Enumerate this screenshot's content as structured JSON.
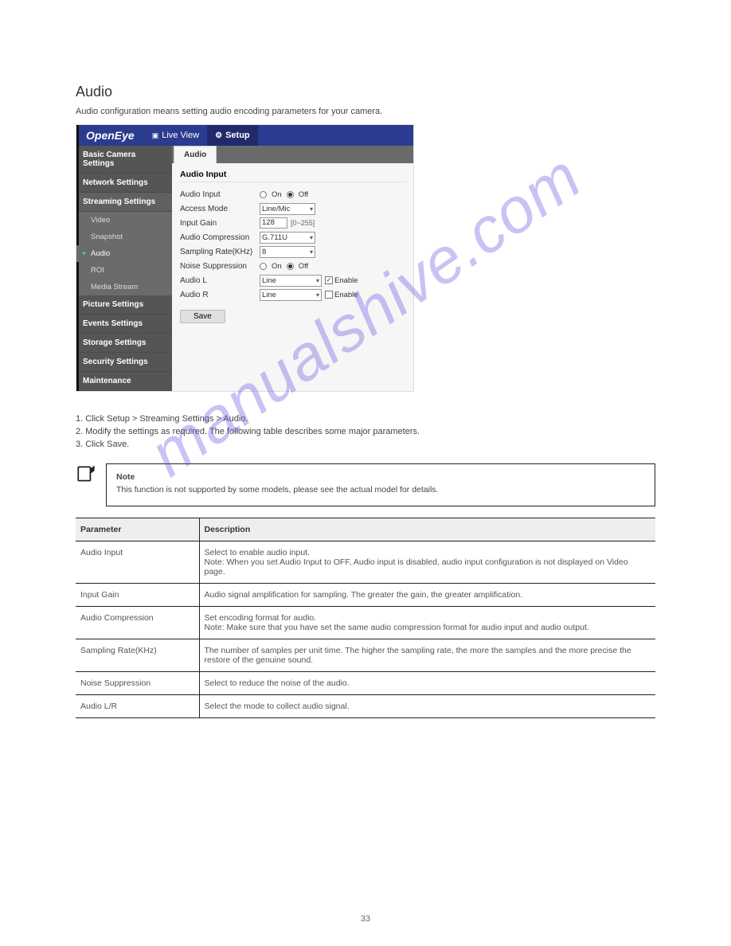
{
  "watermark": "manualshive.com",
  "page_number": "33",
  "section": {
    "title": "Audio",
    "caption": "Audio configuration means setting audio encoding parameters for your camera."
  },
  "screenshot": {
    "logo": "OpenEye",
    "nav": {
      "live": "Live View",
      "setup": "Setup"
    },
    "sidebar": {
      "basic": "Basic Camera Settings",
      "network": "Network Settings",
      "streaming": "Streaming Settings",
      "video": "Video",
      "snapshot": "Snapshot",
      "audio": "Audio",
      "roi": "ROI",
      "media": "Media Stream",
      "picture": "Picture Settings",
      "events": "Events Settings",
      "storage": "Storage Settings",
      "security": "Security Settings",
      "maintenance": "Maintenance"
    },
    "tab": "Audio",
    "form": {
      "group": "Audio Input",
      "audio_input_label": "Audio Input",
      "on": "On",
      "off": "Off",
      "access_mode_label": "Access Mode",
      "access_mode_value": "Line/Mic",
      "input_gain_label": "Input Gain",
      "input_gain_value": "128",
      "input_gain_hint": "[0~255]",
      "compression_label": "Audio Compression",
      "compression_value": "G.711U",
      "sampling_label": "Sampling Rate(KHz)",
      "sampling_value": "8",
      "noise_label": "Noise Suppression",
      "audio_l_label": "Audio L",
      "audio_l_value": "Line",
      "audio_r_label": "Audio R",
      "audio_r_value": "Line",
      "enable": "Enable",
      "save": "Save"
    }
  },
  "steps": {
    "s1": "1. Click Setup > Streaming Settings > Audio.",
    "s2": "2. Modify the settings as required. The following table describes some major parameters.",
    "s3": "3. Click Save."
  },
  "note": {
    "head": "Note",
    "body": "This function is not supported by some models, please see the actual model for details."
  },
  "table": {
    "h1": "Parameter",
    "h2": "Description",
    "rows": {
      "r0_p": "Audio Input",
      "r0_d1": "Select to enable audio input.",
      "r0_d2": "Note: When you set Audio Input to OFF, Audio input is disabled, audio input configuration is not displayed on Video page.",
      "r1_p": "Input Gain",
      "r1_d": "Audio signal amplification for sampling. The greater the gain, the greater amplification.",
      "r2_p": "Audio Compression",
      "r2_d1": "Set encoding format for audio.",
      "r2_d2": "Note: Make sure that you have set the same audio compression format for audio input and audio output.",
      "r3_p": "Sampling Rate(KHz)",
      "r3_d": "The number of samples per unit time. The higher the sampling rate, the more the samples and the more precise the restore of the genuine sound.",
      "r4_p": "Noise Suppression",
      "r4_d": "Select to reduce the noise of the audio.",
      "r5_p": "Audio L/R",
      "r5_d": "Select the mode to collect audio signal."
    }
  }
}
